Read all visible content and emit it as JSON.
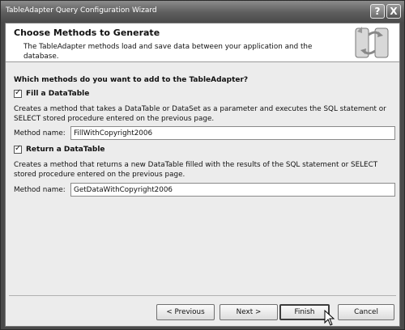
{
  "window": {
    "title": "TableAdapter Query Configuration Wizard",
    "help_glyph": "?",
    "close_glyph": "X"
  },
  "header": {
    "title": "Choose Methods to Generate",
    "description": "The TableAdapter methods load and save data between your application and the database.",
    "icon": "database-sync-icon"
  },
  "question": "Which methods do you want to add to the TableAdapter?",
  "fill_section": {
    "checked": true,
    "check_glyph": "✓",
    "label": "Fill a DataTable",
    "description": "Creates a method that takes a DataTable or DataSet as a parameter and executes the SQL statement or SELECT stored procedure entered on the previous page.",
    "method_label": "Method name:",
    "method_value": "FillWithCopyright2006"
  },
  "return_section": {
    "checked": true,
    "check_glyph": "✓",
    "label": "Return a DataTable",
    "description": "Creates a method that returns a new DataTable filled with the results of the SQL statement or SELECT stored procedure entered on the previous page.",
    "method_label": "Method name:",
    "method_value": "GetDataWithCopyright2006"
  },
  "buttons": {
    "previous": "< Previous",
    "next": "Next >",
    "finish": "Finish",
    "cancel": "Cancel"
  }
}
